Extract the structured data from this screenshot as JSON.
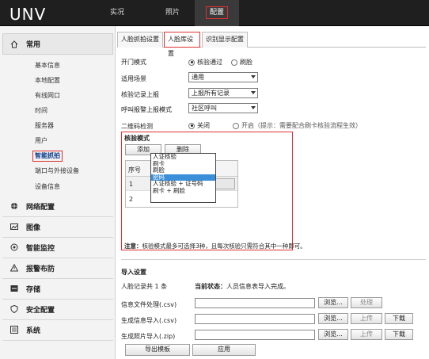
{
  "brand": {
    "logo_text": "UNV"
  },
  "nav": {
    "tabs": [
      "实况",
      "照片",
      "配置"
    ]
  },
  "sidebar": {
    "header": "常用",
    "items": [
      "基本信息",
      "本地配置",
      "有线网口",
      "时间",
      "服务器",
      "用户",
      "智能抓拍",
      "端口与外接设备",
      "设备信息"
    ],
    "sections": [
      "网络配置",
      "图像",
      "智能监控",
      "报警布防",
      "存储",
      "安全配置",
      "系统"
    ]
  },
  "content_tabs": [
    "人脸抓拍设置",
    "人脸库设置",
    "识别显示配置"
  ],
  "form": {
    "door_mode_label": "开门模式",
    "door_mode_options": [
      "核验通过",
      "刷脸"
    ],
    "scene_label": "适用场景",
    "scene_value": "通用",
    "record_label": "核验记录上报",
    "record_value": "上报所有记录",
    "intercom_label": "呼叫报警上报模式",
    "intercom_value": "社区呼叫",
    "qr_label": "二维码检测",
    "qr_options": [
      "关闭",
      "开启（提示：需要配合刷卡核验流程生效）"
    ]
  },
  "verify": {
    "title": "核验模式",
    "add": "添加",
    "delete": "删除",
    "col_no": "序号",
    "rows": [
      "1",
      "2"
    ],
    "dropdown": [
      "人证核验",
      "刷卡",
      "刷脸",
      "密码",
      "人证核验 + 证号码",
      "刷卡 + 刷脸"
    ],
    "selected_index": 3,
    "note_label": "注意：",
    "note": "核验模式最多可选择3种，且每次核验只需符合其中一种即可。"
  },
  "import": {
    "title": "导入设置",
    "total_label": "人脸记录共 1 条",
    "status_label": "当前状态：",
    "status_value": "人员信息表导入完成。",
    "rows": [
      {
        "label": "信息文件处理(.csv)",
        "browse": "浏览...",
        "action": "处理"
      },
      {
        "label": "生成信息导入(.csv)",
        "browse": "浏览...",
        "action": "上传",
        "extra": "下载"
      },
      {
        "label": "生成照片导入(.zip)",
        "browse": "浏览...",
        "action": "上传",
        "extra": "下载"
      }
    ],
    "export_btn": "导出模板",
    "apply_btn": "应用"
  }
}
